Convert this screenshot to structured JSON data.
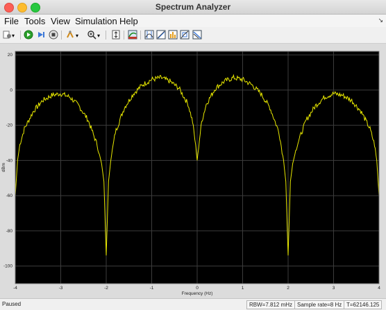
{
  "window": {
    "title": "Spectrum Analyzer"
  },
  "menu": {
    "items": [
      "File",
      "Tools",
      "View",
      "Simulation",
      "Help"
    ],
    "collapse_arrow": "↘"
  },
  "toolbar": {
    "icons": [
      "settings-icon",
      "run-icon",
      "step-forward-icon",
      "stop-icon",
      "highlight-icon",
      "zoom-icon",
      "axes-scaling-icon",
      "data-cursor-icon",
      "peak-finder-icon",
      "distortion-icon",
      "ccdf-icon",
      "channel-measurement-icon",
      "spectral-mask-icon"
    ]
  },
  "status": {
    "state": "Paused",
    "rbw": "RBW=7.812 mHz",
    "sample_rate": "Sample rate=8 Hz",
    "time": "T=62146.125"
  },
  "chart_data": {
    "type": "line",
    "title": "",
    "xlabel": "Frequency (Hz)",
    "ylabel": "dBm",
    "xlim": [
      -4,
      4
    ],
    "ylim": [
      -110,
      22
    ],
    "xticks": [
      -4,
      -3,
      -2,
      -1,
      0,
      1,
      2,
      3,
      4
    ],
    "yticks": [
      20,
      0,
      -20,
      -40,
      -60,
      -80,
      -100
    ],
    "grid": true,
    "colors": {
      "background": "#000000",
      "grid": "#3d3d3d",
      "trace": "#e8e800",
      "tick_text": "#e6e6e6"
    },
    "series": [
      {
        "x": [
          -4.0,
          -3.95,
          -3.9,
          -3.8,
          -3.6,
          -3.4,
          -3.2,
          -3.0,
          -2.8,
          -2.6,
          -2.4,
          -2.2,
          -2.1,
          -2.05,
          -2.0,
          -1.95,
          -1.9,
          -1.8,
          -1.6,
          -1.4,
          -1.2,
          -1.0,
          -0.8,
          -0.6,
          -0.4,
          -0.2,
          -0.1,
          -0.05,
          0.0,
          0.05,
          0.1,
          0.2,
          0.4,
          0.6,
          0.8,
          1.0,
          1.2,
          1.4,
          1.6,
          1.8,
          1.9,
          1.95,
          2.0,
          2.05,
          2.1,
          2.2,
          2.4,
          2.6,
          2.8,
          3.0,
          3.2,
          3.4,
          3.6,
          3.8,
          3.9,
          3.95,
          4.0
        ],
        "y": [
          -60,
          -40,
          -31,
          -22,
          -12,
          -6,
          -3,
          -2,
          -4,
          -9,
          -17,
          -31,
          -42,
          -52,
          -94,
          -52,
          -40,
          -24,
          -10,
          -2,
          3,
          6,
          7,
          5,
          1,
          -8,
          -18,
          -28,
          -40,
          -28,
          -18,
          -8,
          1,
          5,
          7,
          6,
          3,
          -2,
          -10,
          -24,
          -40,
          -52,
          -94,
          -52,
          -42,
          -31,
          -17,
          -9,
          -4,
          -2,
          -3,
          -6,
          -12,
          -22,
          -31,
          -40,
          -60
        ]
      }
    ]
  }
}
